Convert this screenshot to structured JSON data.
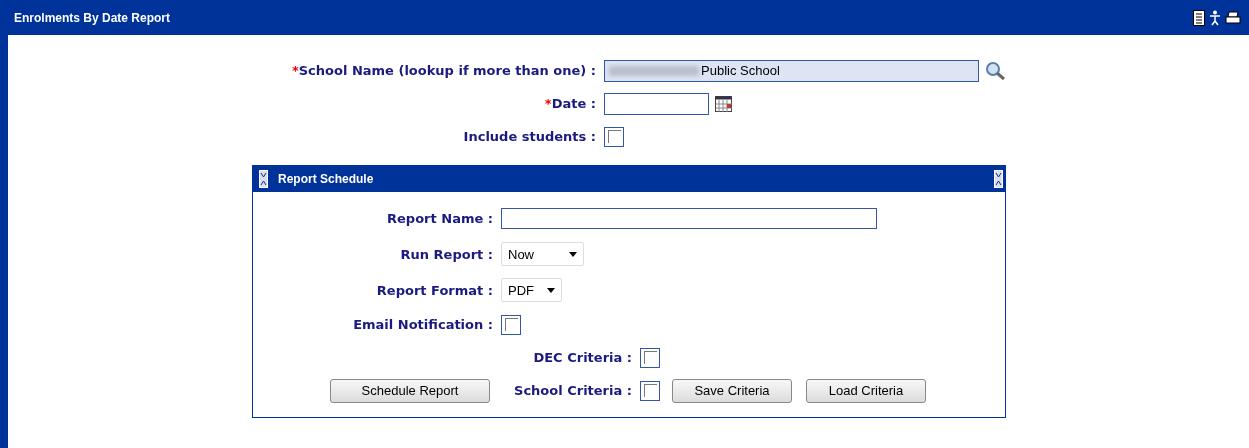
{
  "window": {
    "title": "Enrolments By Date Report"
  },
  "form": {
    "school_name": {
      "label": "School Name (lookup if more than one) :",
      "required_mark": "*",
      "value": "Public School"
    },
    "date": {
      "label": "Date :",
      "required_mark": "*"
    },
    "include_students": {
      "label": "Include students :",
      "checked": false
    }
  },
  "report_schedule": {
    "title": "Report Schedule",
    "report_name": {
      "label": "Report Name :"
    },
    "run_report": {
      "label": "Run Report :",
      "value": "Now"
    },
    "report_format": {
      "label": "Report Format :",
      "value": "PDF"
    },
    "email_notification": {
      "label": "Email Notification :",
      "checked": false
    },
    "dec_criteria": {
      "label": "DEC Criteria :",
      "checked": false
    },
    "school_criteria": {
      "label": "School Criteria :",
      "checked": false
    },
    "buttons": {
      "schedule": "Schedule Report",
      "save": "Save Criteria",
      "load": "Load Criteria"
    }
  }
}
